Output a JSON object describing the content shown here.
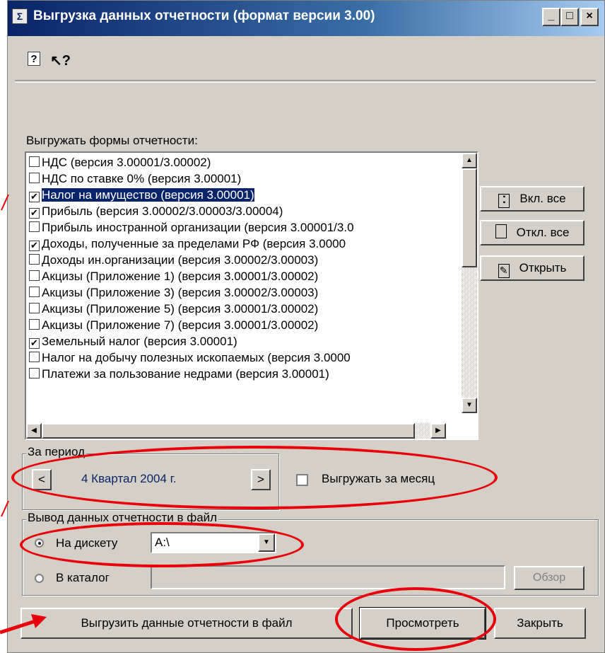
{
  "window": {
    "title": "Выгрузка данных отчетности (формат версии 3.00)",
    "controls": {
      "minimize": "_",
      "maximize": "□",
      "close": "×"
    }
  },
  "toolbar": {
    "help_label": "?",
    "whats_this_label": "↖?"
  },
  "forms": {
    "label": "Выгружать формы отчетности:",
    "items": [
      {
        "label": "НДС (версия 3.00001/3.00002)",
        "checked": false,
        "mark": ""
      },
      {
        "label": "НДС по ставке 0% (версия 3.00001)",
        "checked": false,
        "mark": ""
      },
      {
        "label": "Налог на имущество (версия 3.00001)",
        "checked": true,
        "mark": "✔"
      },
      {
        "label": "Прибыль (версия 3.00002/3.00003/3.00004)",
        "checked": true,
        "mark": "✔"
      },
      {
        "label": "Прибыль иностранной организации (версия 3.00001/3.0",
        "checked": false,
        "mark": ""
      },
      {
        "label": "Доходы, полученные за пределами РФ (версия 3.0000",
        "checked": true,
        "mark": "✔"
      },
      {
        "label": "Доходы ин.организации (версия 3.00002/3.00003)",
        "checked": false,
        "mark": ""
      },
      {
        "label": "Акцизы (Приложение 1) (версия 3.00001/3.00002)",
        "checked": false,
        "mark": ""
      },
      {
        "label": "Акцизы (Приложение 3) (версия 3.00002/3.00003)",
        "checked": false,
        "mark": ""
      },
      {
        "label": "Акцизы (Приложение 5) (версия 3.00001/3.00002)",
        "checked": false,
        "mark": ""
      },
      {
        "label": "Акцизы (Приложение 7) (версия 3.00001/3.00002)",
        "checked": false,
        "mark": ""
      },
      {
        "label": "Земельный налог (версия 3.00001)",
        "checked": true,
        "mark": "✔"
      },
      {
        "label": "Налог на добычу полезных ископаемых (версия 3.0000",
        "checked": false,
        "mark": ""
      },
      {
        "label": "Платежи за пользование недрами (версия 3.00001)",
        "checked": false,
        "mark": ""
      }
    ],
    "selected_index": 2
  },
  "side_buttons": {
    "select_all": "Вкл. все",
    "deselect_all": "Откл. все",
    "open": "Открыть"
  },
  "period": {
    "group_title": "За период",
    "prev": "<",
    "value": "4 Квартал 2004 г.",
    "next": ">",
    "monthly_label": "Выгружать за месяц",
    "monthly_checked": false
  },
  "output": {
    "group_title": "Вывод данных отчетности в файл",
    "floppy_label": "На дискету",
    "floppy_selected": true,
    "drive_value": "A:\\",
    "folder_label": "В каталог",
    "folder_selected": false,
    "folder_value": "",
    "browse_label": "Обзор"
  },
  "footer": {
    "export_label": "Выгрузить данные отчетности в файл",
    "preview_label": "Просмотреть",
    "close_label": "Закрыть"
  },
  "colors": {
    "annotation": "#e8000c",
    "title_bar": "#0a246a",
    "period_text": "#0a2468"
  }
}
